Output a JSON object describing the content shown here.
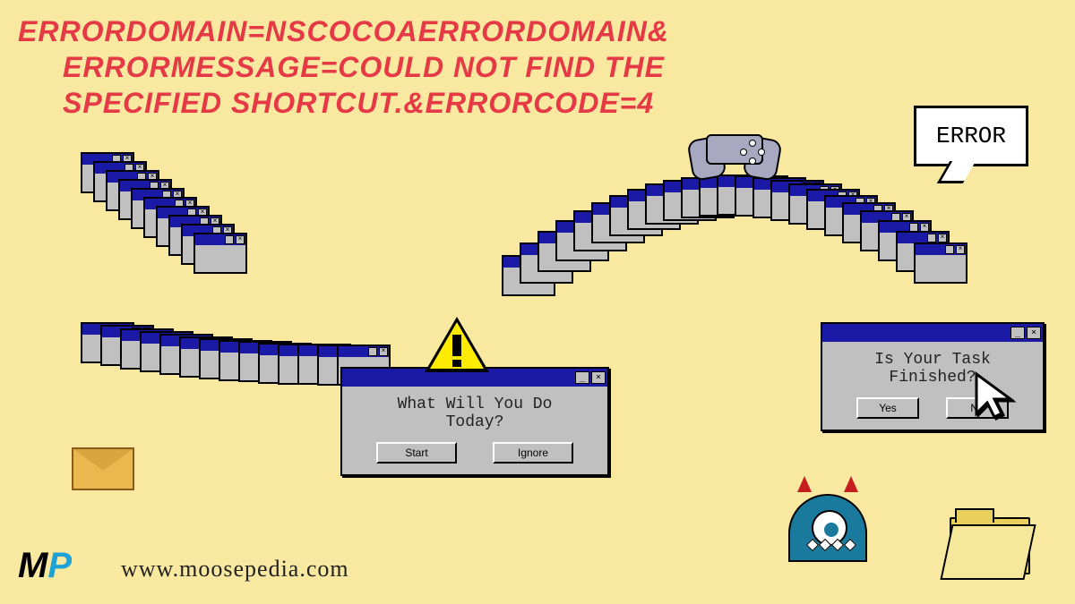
{
  "headline": {
    "line1": "ERRORDOMAIN=NSCOCOAERRORDOMAIN&",
    "line2": "ERRORMESSAGE=COULD NOT FIND THE",
    "line3": "SPECIFIED SHORTCUT.&ERRORCODE=4"
  },
  "dialog1": {
    "message_l1": "What Will You Do",
    "message_l2": "Today?",
    "btn_start": "Start",
    "btn_ignore": "Ignore"
  },
  "dialog2": {
    "message_l1": "Is Your Task",
    "message_l2": "Finished?",
    "btn_yes": "Yes",
    "btn_no": "No"
  },
  "bubble": {
    "text": "ERROR"
  },
  "footer": {
    "logo_m": "M",
    "logo_p": "P",
    "url": "www.moosepedia.com"
  },
  "ctl": {
    "min": "_",
    "close": "×",
    "x": "×"
  }
}
